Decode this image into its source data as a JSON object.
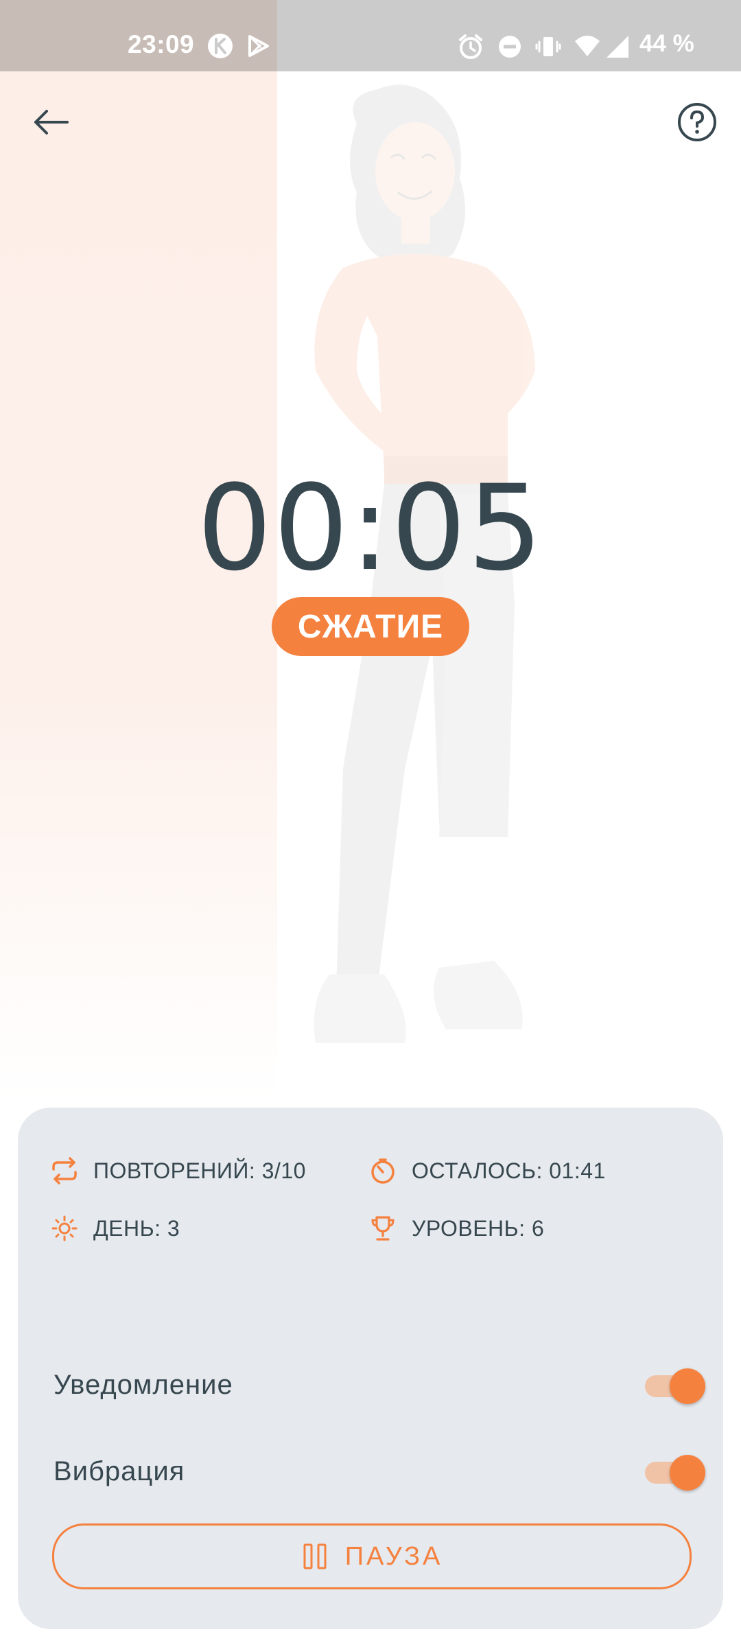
{
  "status_bar": {
    "time": "23:09",
    "battery": "44 %",
    "icons": [
      "k-app-icon",
      "play-store-icon",
      "alarm-icon",
      "do-not-disturb-icon",
      "vibrate-icon",
      "wifi-icon",
      "signal-icon"
    ]
  },
  "header": {
    "back_icon": "arrow-left-icon",
    "help_icon": "question-circle-icon"
  },
  "exercise": {
    "timer": "00:05",
    "phase": "СЖАТИЕ"
  },
  "stats": {
    "repetitions": "ПОВТОРЕНИЙ: 3/10",
    "remaining": "ОСТАЛОСЬ: 01:41",
    "day": "ДЕНЬ: 3",
    "level": "УРОВЕНЬ: 6"
  },
  "settings": {
    "notification": {
      "label": "Уведомление",
      "enabled": true
    },
    "vibration": {
      "label": "Вибрация",
      "enabled": true
    }
  },
  "pause_button": {
    "label": "ПАУЗА"
  },
  "colors": {
    "accent": "#f5813f",
    "text": "#37474f",
    "card_bg": "#e6e9ed",
    "status_bar": "#cbcbcb"
  }
}
